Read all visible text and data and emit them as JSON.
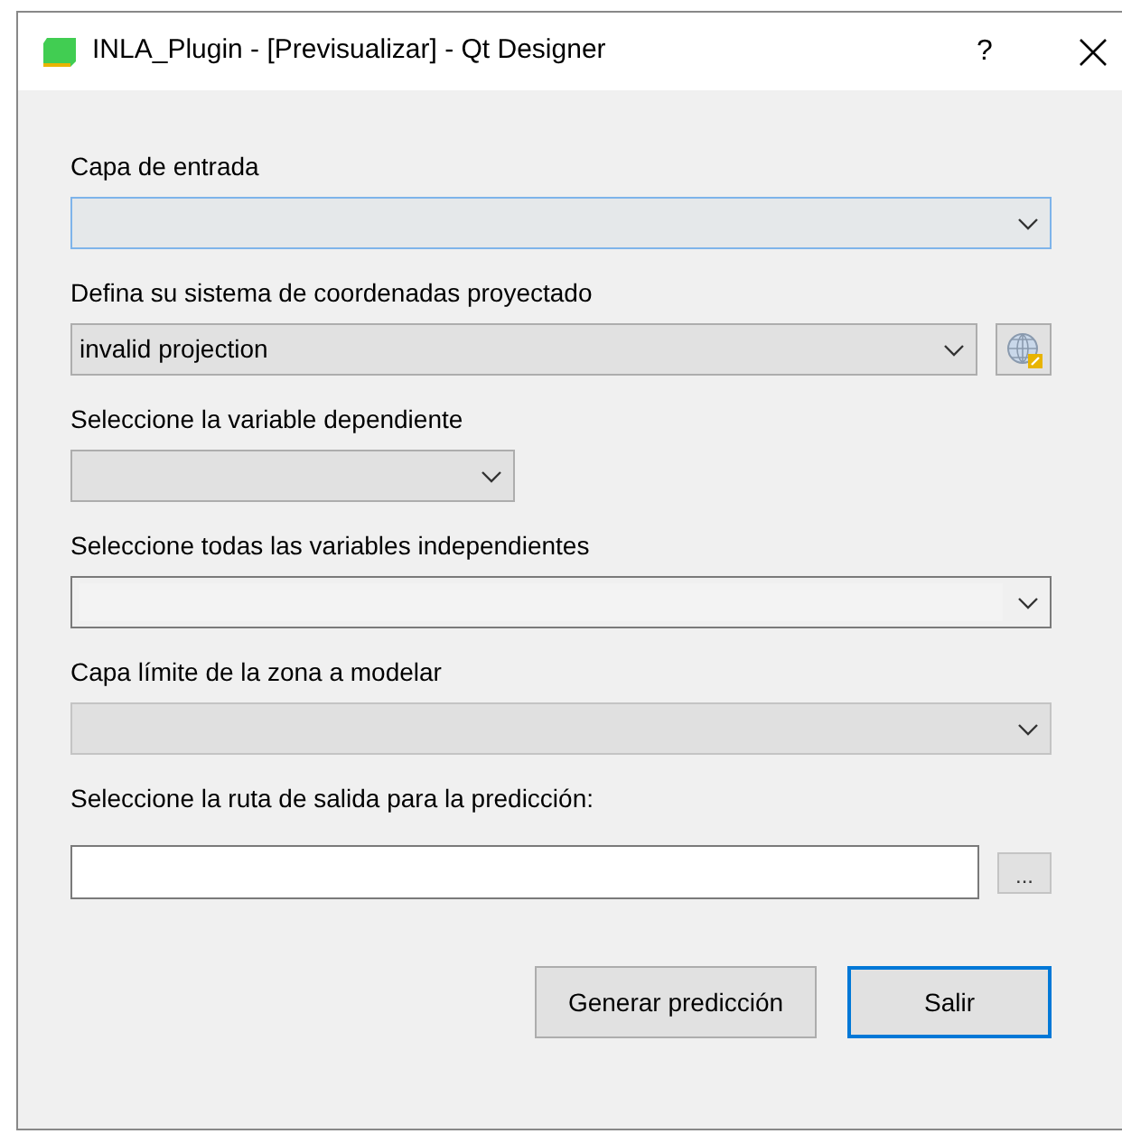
{
  "window": {
    "title": "INLA_Plugin - [Previsualizar] - Qt Designer",
    "help": "?"
  },
  "fields": [
    {
      "kind": "combo",
      "label": "Capa de entrada",
      "hovered": true,
      "editable": false,
      "disabled": false,
      "compact": false,
      "projection_button": false
    },
    {
      "kind": "combo",
      "label": "Defina su sistema de coordenadas proyectado",
      "value": "invalid projection",
      "hovered": false,
      "editable": false,
      "disabled": false,
      "compact": false,
      "projection_button": true
    },
    {
      "kind": "combo",
      "label": "Seleccione la variable dependiente",
      "hovered": false,
      "editable": false,
      "disabled": false,
      "compact": true,
      "projection_button": false
    },
    {
      "kind": "combo",
      "label": "Seleccione todas las variables independientes",
      "hovered": false,
      "editable": true,
      "disabled": false,
      "compact": false,
      "projection_button": false
    },
    {
      "kind": "combo",
      "label": "Capa límite de la zona a modelar",
      "hovered": false,
      "editable": false,
      "disabled": true,
      "compact": false,
      "projection_button": false
    },
    {
      "kind": "text",
      "label": "Seleccione la ruta de salida para la predicción:",
      "browse_label": "..."
    }
  ],
  "buttons": [
    {
      "label": "Generar predicción",
      "focused": false
    },
    {
      "label": "Salir",
      "focused": true
    }
  ]
}
